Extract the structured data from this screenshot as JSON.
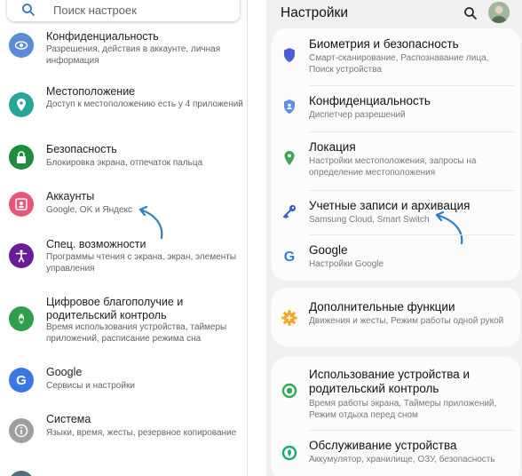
{
  "left": {
    "search_placeholder": "Поиск настроек",
    "items": [
      {
        "title": "Конфиденциальность",
        "subtitle": "Разрешения, действия в аккаунте, личная информация",
        "icon": "eye-icon",
        "color": "#5c8bd6"
      },
      {
        "title": "Местоположение",
        "subtitle": "Доступ к местоположению есть у 4 приложений",
        "icon": "location-pin-icon",
        "color": "#26a69a"
      },
      {
        "title": "Безопасность",
        "subtitle": "Блокировка экрана, отпечаток пальца",
        "icon": "lock-icon",
        "color": "#1e8e3e"
      },
      {
        "title": "Аккаунты",
        "subtitle": "Google, OK и Яндекс",
        "icon": "account-icon",
        "color": "#e8567a"
      },
      {
        "title": "Спец. возможности",
        "subtitle": "Программы чтения с экрана, экран, элементы управления",
        "icon": "accessibility-icon",
        "color": "#6a1b9a"
      },
      {
        "title": "Цифровое благополучие и родительский контроль",
        "subtitle": "Время использования устройства, таймеры приложений, расписание режима сна",
        "icon": "wellbeing-icon",
        "color": "#2e9e4a"
      },
      {
        "title": "Google",
        "subtitle": "Сервисы и настройки",
        "icon": "google-g-icon",
        "color": "#3b78e7"
      },
      {
        "title": "Система",
        "subtitle": "Языки, время, жесты, резервное копирование",
        "icon": "info-icon",
        "color": "#9e9e9e"
      }
    ]
  },
  "right": {
    "title": "Настройки",
    "cards": [
      {
        "items": [
          {
            "title": "Биометрия и безопасность",
            "subtitle": "Смарт-сканирование, Распознавание лица, Поиск устройства",
            "icon": "shield-icon",
            "color": "#4a5cd6"
          },
          {
            "title": "Конфиденциальность",
            "subtitle": "Диспетчер разрешений",
            "icon": "privacy-shield-icon",
            "color": "#4a78d6"
          },
          {
            "title": "Локация",
            "subtitle": "Настройки местоположения, запросы на определение местоположения",
            "icon": "location-pin-icon",
            "color": "#3aa655"
          },
          {
            "title": "Учетные записи и архивация",
            "subtitle": "Samsung Cloud, Smart Switch",
            "icon": "key-icon",
            "color": "#3a5fc8"
          },
          {
            "title": "Google",
            "subtitle": "Настройки Google",
            "icon": "google-g-icon",
            "color": "#3b78e7"
          }
        ]
      },
      {
        "items": [
          {
            "title": "Дополнительные функции",
            "subtitle": "Движения и жесты, Режим работы одной рукой",
            "icon": "gear-plus-icon",
            "color": "#f5a623"
          }
        ]
      },
      {
        "items": [
          {
            "title": "Использование устройства и родительский контроль",
            "subtitle": "Время работы экрана, Таймеры приложений, Режим отдыха перед сном",
            "icon": "wellbeing-icon",
            "color": "#2eaa55"
          },
          {
            "title": "Обслуживание устройства",
            "subtitle": "Аккумулятор, хранилище, ОЗУ, безопасность",
            "icon": "device-care-icon",
            "color": "#1aa57a"
          }
        ]
      }
    ]
  }
}
